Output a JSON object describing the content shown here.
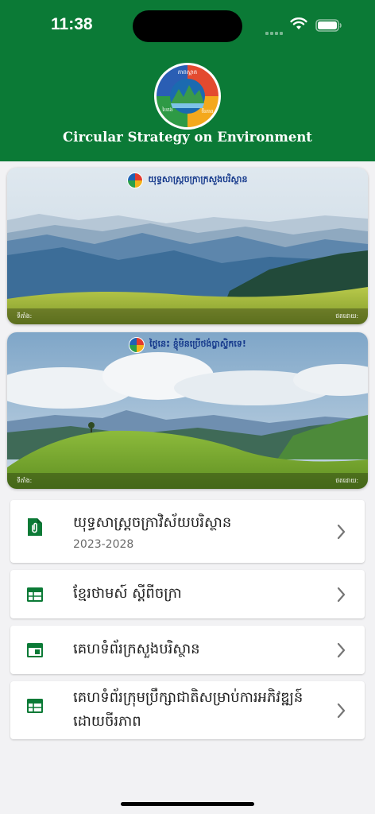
{
  "status_bar": {
    "time": "11:38"
  },
  "header": {
    "logo_text_top": "ភាពស្អាត",
    "logo_text_left": "បៃតង",
    "logo_text_right": "ចីរភាព",
    "title": "Circular Strategy on Environment"
  },
  "banners": [
    {
      "caption": "យុទ្ធសាស្ត្រចក្រាក្រសួងបរិស្ថាន",
      "location": "ទីតាំង:",
      "photographer": "ថតដោយ:"
    },
    {
      "caption": "ថ្ងៃនេះ ខ្ញុំមិនប្រើថង់ប្លាស្ទិកទេ!",
      "location": "ទីតាំង:",
      "photographer": "ថតដោយ:"
    }
  ],
  "menu": [
    {
      "title": "យុទ្ធសាស្ត្រចក្រាវិស័យបរិស្ថាន",
      "subtitle": "2023-2028",
      "icon": "pdf-document-icon"
    },
    {
      "title": "ខ្មែរថាមស៍ ស្ដីពីចក្រា",
      "icon": "calendar-grid-icon"
    },
    {
      "title": "គេហទំព័រក្រសួងបរិស្ថាន",
      "icon": "web-window-icon"
    },
    {
      "title": "គេហទំព័រក្រុមប្រឹក្សាជាតិសម្រាប់ការអភិវឌ្ឍន៍ដោយចីរភាព",
      "icon": "calendar-grid-icon"
    }
  ],
  "colors": {
    "brand_green": "#0b7a36",
    "background": "#f2f2f4",
    "icon_green": "#0b7a36"
  }
}
